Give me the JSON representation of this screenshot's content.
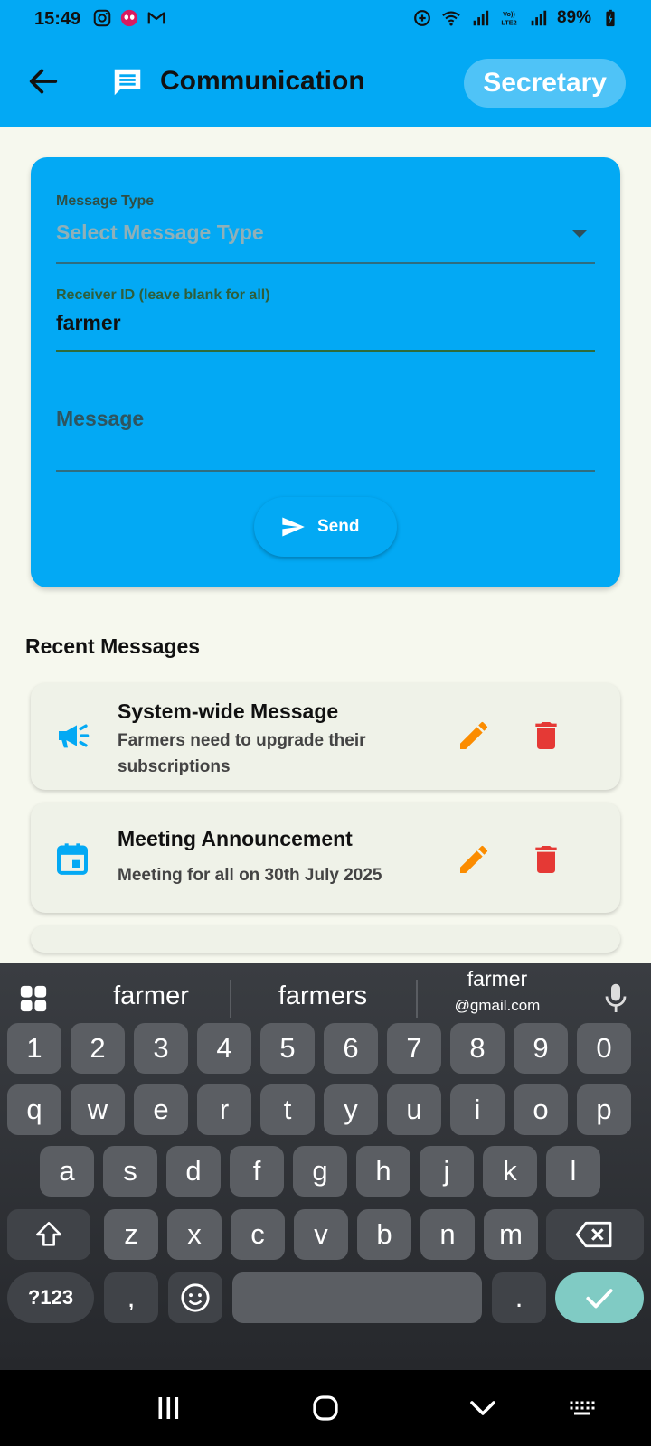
{
  "status_bar": {
    "time": "15:49",
    "battery": "89%",
    "icons_left": [
      "instagram-icon",
      "spider-app-icon",
      "gmail-icon"
    ],
    "icons_right": [
      "data-saver-icon",
      "wifi-icon",
      "signal-icon",
      "volte-icon",
      "signal2-icon",
      "battery-charging-icon"
    ]
  },
  "app_bar": {
    "title": "Communication",
    "role": "Secretary",
    "colors": {
      "primary": "#03a9f4",
      "chip": "#4fc3f7"
    }
  },
  "form": {
    "message_type_label": "Message Type",
    "message_type_placeholder": "Select Message Type",
    "receiver_label": "Receiver ID (leave blank for all)",
    "receiver_value": "farmer",
    "message_placeholder": "Message",
    "send_label": "Send"
  },
  "recent": {
    "title": "Recent Messages",
    "messages": [
      {
        "icon": "megaphone-icon",
        "title": "System-wide Message",
        "body": "Farmers need to upgrade their subscriptions"
      },
      {
        "icon": "calendar-icon",
        "title": "Meeting Announcement",
        "body": "Meeting for all on 30th July 2025"
      }
    ],
    "colors": {
      "edit": "#fb8c00",
      "delete": "#e53935",
      "lead": "#03a9f4"
    }
  },
  "keyboard": {
    "suggestions": [
      "farmer",
      "farmers",
      "farmer",
      "@gmail.com"
    ],
    "row_numbers": [
      "1",
      "2",
      "3",
      "4",
      "5",
      "6",
      "7",
      "8",
      "9",
      "0"
    ],
    "row_q": [
      "q",
      "w",
      "e",
      "r",
      "t",
      "y",
      "u",
      "i",
      "o",
      "p"
    ],
    "row_a": [
      "a",
      "s",
      "d",
      "f",
      "g",
      "h",
      "j",
      "k",
      "l"
    ],
    "row_z": [
      "z",
      "x",
      "c",
      "v",
      "b",
      "n",
      "m"
    ],
    "sym_key": "?123",
    "comma_key": ",",
    "period_key": "."
  }
}
